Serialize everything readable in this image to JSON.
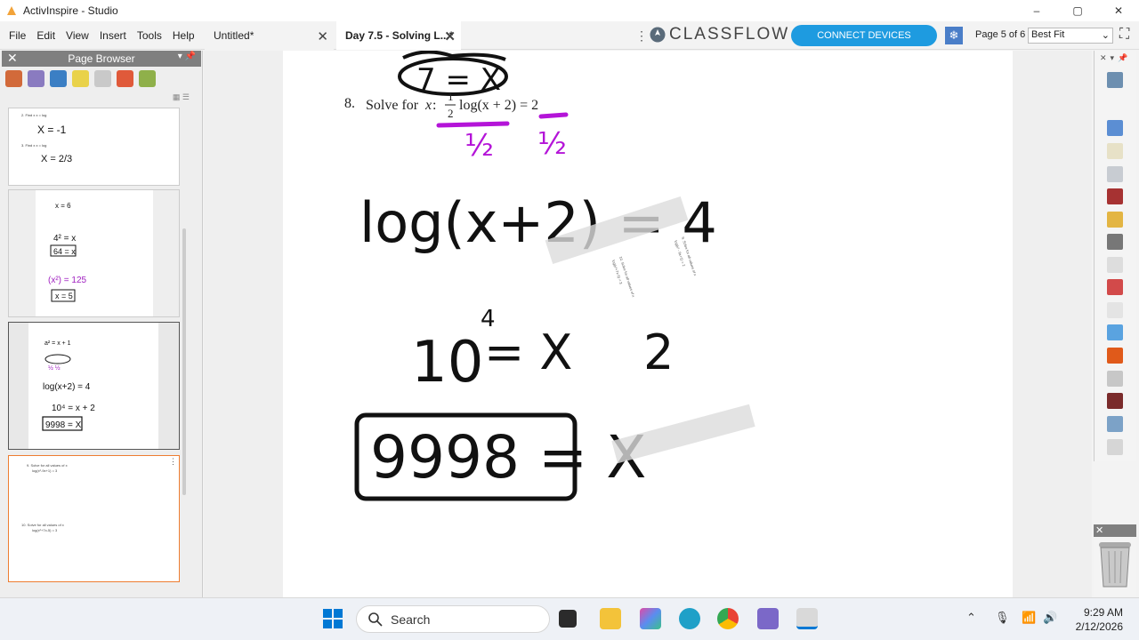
{
  "window": {
    "title": "ActivInspire - Studio",
    "controls": {
      "minimize": "–",
      "maximize": "▢",
      "close": "✕"
    }
  },
  "menu": [
    "File",
    "Edit",
    "View",
    "Insert",
    "Tools",
    "Help"
  ],
  "tabs": [
    {
      "label": "Untitled*",
      "close": "✕"
    },
    {
      "label": "Day 7.5 - Solving L...*",
      "close": "✕"
    }
  ],
  "toolbar": {
    "brand": "CLASSFLOW",
    "connect_label": "CONNECT DEVICES",
    "page_info": "Page 5 of 6",
    "zoom": "Best Fit"
  },
  "page_browser": {
    "title": "Page Browser",
    "close": "✕",
    "pins": "▾ 📌"
  },
  "thumbnails": [
    {
      "lines": [
        "2. Find x  x = log",
        "X = -1",
        "3. Find x  x = log",
        "X = 2/3"
      ]
    },
    {
      "lines": [
        "x = 6",
        "4² = x",
        "64 = x",
        "(x²) = 125",
        "x = 5"
      ]
    },
    {
      "lines": [
        "a² = x + 1",
        "log(x+2) = 4",
        "10⁴ = x + 2",
        "9998 = X"
      ]
    },
    {
      "lines": [
        "9. Solve for all values of x",
        "log(x²-9x+1) = 3",
        "10. Solve for all values of x",
        "log(x²+7x-5) = 3"
      ]
    }
  ],
  "canvas": {
    "problem_number": "8.",
    "problem_prefix": "Solve for",
    "problem_var": "x",
    "problem_eq": "log(x + 2) = 2",
    "frac_num": "1",
    "frac_den": "2",
    "handwriting": {
      "top_answer": "7 = X",
      "step1": "log(x+2) = 4",
      "step2_base": "10",
      "step2_exp": "4",
      "step2_rest": "= X + 2",
      "answer": "9998 = X",
      "half": "1/2"
    },
    "faint_text_a": "9. Solve for all values of x",
    "faint_text_b": "log(x² - 9x+1) = 2",
    "faint_text_c": "10. Solve for all values of x",
    "faint_text_d": "log(x²+7x-5) = 3"
  },
  "taskbar": {
    "search_placeholder": "Search",
    "time": "9:29 AM",
    "date": "2/12/2026"
  },
  "colors": {
    "accent": "#1e9be0",
    "purple_ink": "#b414d8",
    "selected_border": "#ee7d31"
  }
}
